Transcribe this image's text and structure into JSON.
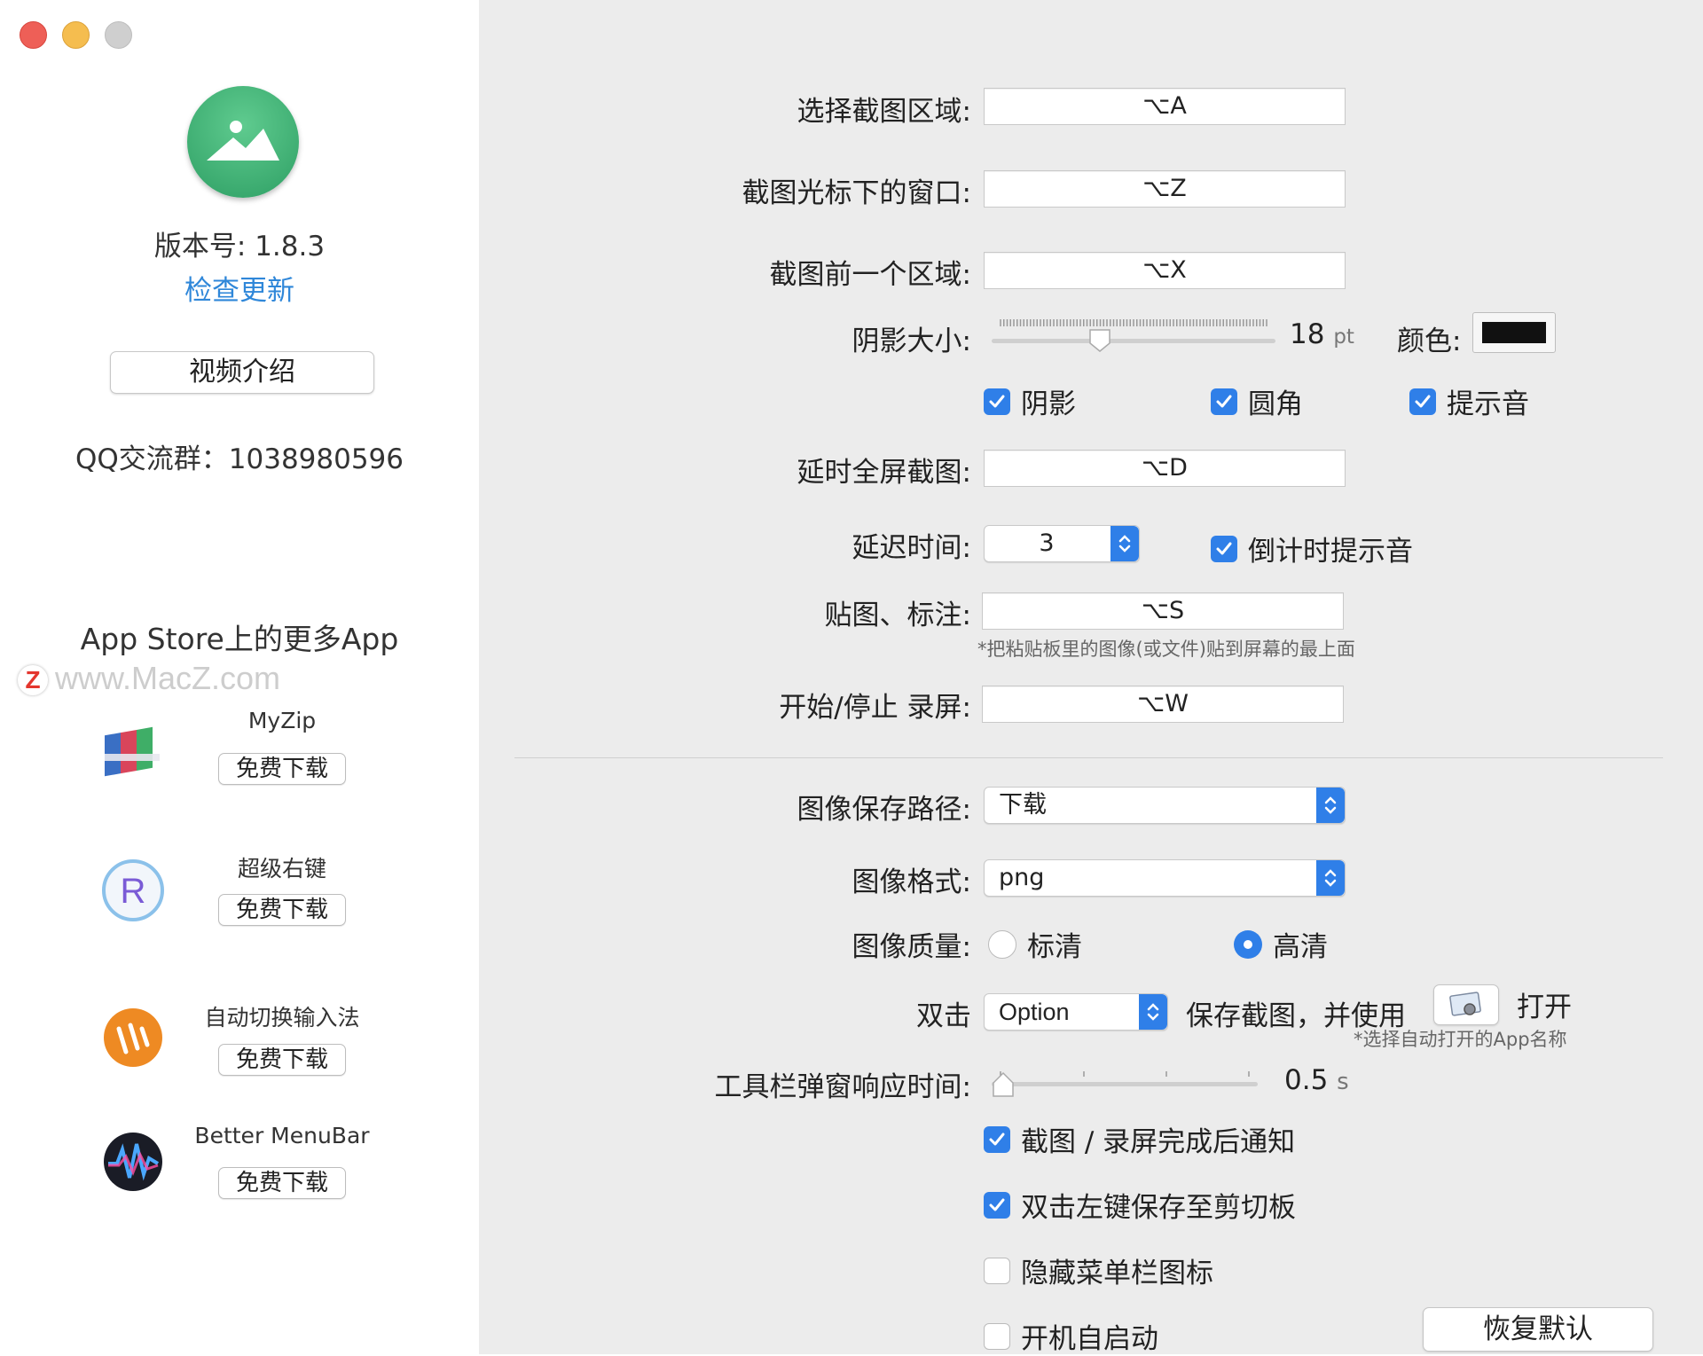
{
  "sidebar": {
    "version": "版本号: 1.8.3",
    "check_update": "检查更新",
    "video_intro": "视频介绍",
    "qq_group": "QQ交流群：1038980596",
    "more_apps": "App Store上的更多App",
    "watermark": "www.MacZ.com",
    "watermark_logo": "Z",
    "promos": [
      {
        "name": "MyZip",
        "button": "免费下载",
        "icon": "archive-books-icon"
      },
      {
        "name": "超级右键",
        "button": "免费下载",
        "icon": "r-circle-icon"
      },
      {
        "name": "自动切换输入法",
        "button": "免费下载",
        "icon": "w-orange-icon"
      },
      {
        "name": "Better MenuBar",
        "button": "免费下载",
        "icon": "wave-icon"
      }
    ]
  },
  "settings": {
    "select_region": {
      "label": "选择截图区域:",
      "value": "⌥A"
    },
    "window_under_cursor": {
      "label": "截图光标下的窗口:",
      "value": "⌥Z"
    },
    "previous_region": {
      "label": "截图前一个区域:",
      "value": "⌥X"
    },
    "shadow_size": {
      "label": "阴影大小:",
      "value": "18",
      "unit": "pt",
      "level": 0.37
    },
    "color": {
      "label": "颜色:",
      "value": "#111111"
    },
    "checks_row1": [
      {
        "label": "阴影",
        "checked": true
      },
      {
        "label": "圆角",
        "checked": true
      },
      {
        "label": "提示音",
        "checked": true
      }
    ],
    "delayed_fullscreen": {
      "label": "延时全屏截图:",
      "value": "⌥D"
    },
    "delay_time": {
      "label": "延迟时间:",
      "value": "3"
    },
    "countdown_sound": {
      "label": "倒计时提示音",
      "checked": true
    },
    "paste_annotate": {
      "label": "贴图、标注:",
      "value": "⌥S",
      "note": "*把粘贴板里的图像(或文件)贴到屏幕的最上面"
    },
    "record": {
      "label": "开始/停止 录屏:",
      "value": "⌥W"
    },
    "save_path": {
      "label": "图像保存路径:",
      "value": "下载"
    },
    "format": {
      "label": "图像格式:",
      "value": "png"
    },
    "quality": {
      "label": "图像质量:",
      "options": [
        {
          "label": "标清",
          "selected": false
        },
        {
          "label": "高清",
          "selected": true
        }
      ]
    },
    "double_click": {
      "label": "双击",
      "modifier": "Option",
      "middle_text": "保存截图，并使用",
      "open_text": "打开",
      "note": "*选择自动打开的App名称"
    },
    "toolbar_response": {
      "label": "工具栏弹窗响应时间:",
      "value": "0.5",
      "unit": "s",
      "level": 0.0
    },
    "checks_bottom": [
      {
        "label": "截图 / 录屏完成后通知",
        "checked": true
      },
      {
        "label": "双击左键保存至剪切板",
        "checked": true
      },
      {
        "label": "隐藏菜单栏图标",
        "checked": false
      },
      {
        "label": "开机自启动",
        "checked": false
      }
    ],
    "restore_defaults": "恢复默认"
  },
  "colors": {
    "accent": "#2f7fe8",
    "link": "#2f87d9"
  }
}
